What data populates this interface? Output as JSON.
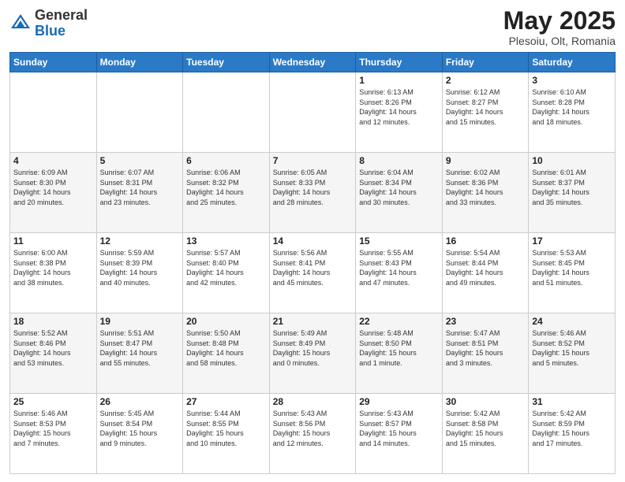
{
  "header": {
    "logo_general": "General",
    "logo_blue": "Blue",
    "month_title": "May 2025",
    "location": "Plesoiu, Olt, Romania"
  },
  "days_of_week": [
    "Sunday",
    "Monday",
    "Tuesday",
    "Wednesday",
    "Thursday",
    "Friday",
    "Saturday"
  ],
  "weeks": [
    [
      {
        "date": "",
        "info": ""
      },
      {
        "date": "",
        "info": ""
      },
      {
        "date": "",
        "info": ""
      },
      {
        "date": "",
        "info": ""
      },
      {
        "date": "1",
        "info": "Sunrise: 6:13 AM\nSunset: 8:26 PM\nDaylight: 14 hours\nand 12 minutes."
      },
      {
        "date": "2",
        "info": "Sunrise: 6:12 AM\nSunset: 8:27 PM\nDaylight: 14 hours\nand 15 minutes."
      },
      {
        "date": "3",
        "info": "Sunrise: 6:10 AM\nSunset: 8:28 PM\nDaylight: 14 hours\nand 18 minutes."
      }
    ],
    [
      {
        "date": "4",
        "info": "Sunrise: 6:09 AM\nSunset: 8:30 PM\nDaylight: 14 hours\nand 20 minutes."
      },
      {
        "date": "5",
        "info": "Sunrise: 6:07 AM\nSunset: 8:31 PM\nDaylight: 14 hours\nand 23 minutes."
      },
      {
        "date": "6",
        "info": "Sunrise: 6:06 AM\nSunset: 8:32 PM\nDaylight: 14 hours\nand 25 minutes."
      },
      {
        "date": "7",
        "info": "Sunrise: 6:05 AM\nSunset: 8:33 PM\nDaylight: 14 hours\nand 28 minutes."
      },
      {
        "date": "8",
        "info": "Sunrise: 6:04 AM\nSunset: 8:34 PM\nDaylight: 14 hours\nand 30 minutes."
      },
      {
        "date": "9",
        "info": "Sunrise: 6:02 AM\nSunset: 8:36 PM\nDaylight: 14 hours\nand 33 minutes."
      },
      {
        "date": "10",
        "info": "Sunrise: 6:01 AM\nSunset: 8:37 PM\nDaylight: 14 hours\nand 35 minutes."
      }
    ],
    [
      {
        "date": "11",
        "info": "Sunrise: 6:00 AM\nSunset: 8:38 PM\nDaylight: 14 hours\nand 38 minutes."
      },
      {
        "date": "12",
        "info": "Sunrise: 5:59 AM\nSunset: 8:39 PM\nDaylight: 14 hours\nand 40 minutes."
      },
      {
        "date": "13",
        "info": "Sunrise: 5:57 AM\nSunset: 8:40 PM\nDaylight: 14 hours\nand 42 minutes."
      },
      {
        "date": "14",
        "info": "Sunrise: 5:56 AM\nSunset: 8:41 PM\nDaylight: 14 hours\nand 45 minutes."
      },
      {
        "date": "15",
        "info": "Sunrise: 5:55 AM\nSunset: 8:43 PM\nDaylight: 14 hours\nand 47 minutes."
      },
      {
        "date": "16",
        "info": "Sunrise: 5:54 AM\nSunset: 8:44 PM\nDaylight: 14 hours\nand 49 minutes."
      },
      {
        "date": "17",
        "info": "Sunrise: 5:53 AM\nSunset: 8:45 PM\nDaylight: 14 hours\nand 51 minutes."
      }
    ],
    [
      {
        "date": "18",
        "info": "Sunrise: 5:52 AM\nSunset: 8:46 PM\nDaylight: 14 hours\nand 53 minutes."
      },
      {
        "date": "19",
        "info": "Sunrise: 5:51 AM\nSunset: 8:47 PM\nDaylight: 14 hours\nand 55 minutes."
      },
      {
        "date": "20",
        "info": "Sunrise: 5:50 AM\nSunset: 8:48 PM\nDaylight: 14 hours\nand 58 minutes."
      },
      {
        "date": "21",
        "info": "Sunrise: 5:49 AM\nSunset: 8:49 PM\nDaylight: 15 hours\nand 0 minutes."
      },
      {
        "date": "22",
        "info": "Sunrise: 5:48 AM\nSunset: 8:50 PM\nDaylight: 15 hours\nand 1 minute."
      },
      {
        "date": "23",
        "info": "Sunrise: 5:47 AM\nSunset: 8:51 PM\nDaylight: 15 hours\nand 3 minutes."
      },
      {
        "date": "24",
        "info": "Sunrise: 5:46 AM\nSunset: 8:52 PM\nDaylight: 15 hours\nand 5 minutes."
      }
    ],
    [
      {
        "date": "25",
        "info": "Sunrise: 5:46 AM\nSunset: 8:53 PM\nDaylight: 15 hours\nand 7 minutes."
      },
      {
        "date": "26",
        "info": "Sunrise: 5:45 AM\nSunset: 8:54 PM\nDaylight: 15 hours\nand 9 minutes."
      },
      {
        "date": "27",
        "info": "Sunrise: 5:44 AM\nSunset: 8:55 PM\nDaylight: 15 hours\nand 10 minutes."
      },
      {
        "date": "28",
        "info": "Sunrise: 5:43 AM\nSunset: 8:56 PM\nDaylight: 15 hours\nand 12 minutes."
      },
      {
        "date": "29",
        "info": "Sunrise: 5:43 AM\nSunset: 8:57 PM\nDaylight: 15 hours\nand 14 minutes."
      },
      {
        "date": "30",
        "info": "Sunrise: 5:42 AM\nSunset: 8:58 PM\nDaylight: 15 hours\nand 15 minutes."
      },
      {
        "date": "31",
        "info": "Sunrise: 5:42 AM\nSunset: 8:59 PM\nDaylight: 15 hours\nand 17 minutes."
      }
    ]
  ]
}
